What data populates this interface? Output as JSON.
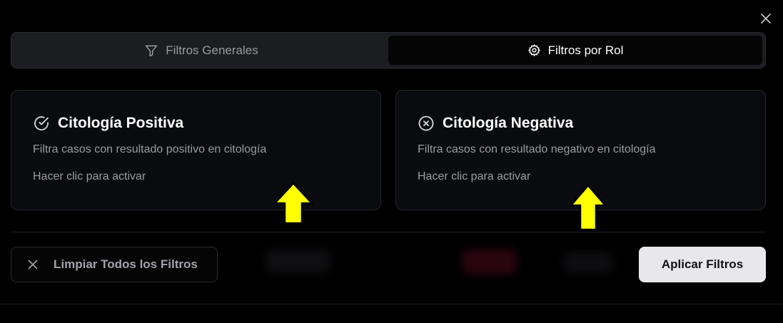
{
  "modal": {
    "close_icon": "x-close-icon"
  },
  "tabs": [
    {
      "label": "Filtros Generales",
      "icon": "filter-icon",
      "active": false
    },
    {
      "label": "Filtros por Rol",
      "icon": "gear-icon",
      "active": true
    }
  ],
  "cards": [
    {
      "title": "Citología Positiva",
      "icon": "check-circle-icon",
      "description": "Filtra casos con resultado positivo en citología",
      "hint": "Hacer clic para activar"
    },
    {
      "title": "Citología Negativa",
      "icon": "x-circle-icon",
      "description": "Filtra casos con resultado negativo en citología",
      "hint": "Hacer clic para activar"
    }
  ],
  "footer": {
    "clear_label": "Limpiar Todos los Filtros",
    "apply_label": "Aplicar Filtros"
  },
  "annotations": {
    "arrow_color": "#ffff00"
  }
}
